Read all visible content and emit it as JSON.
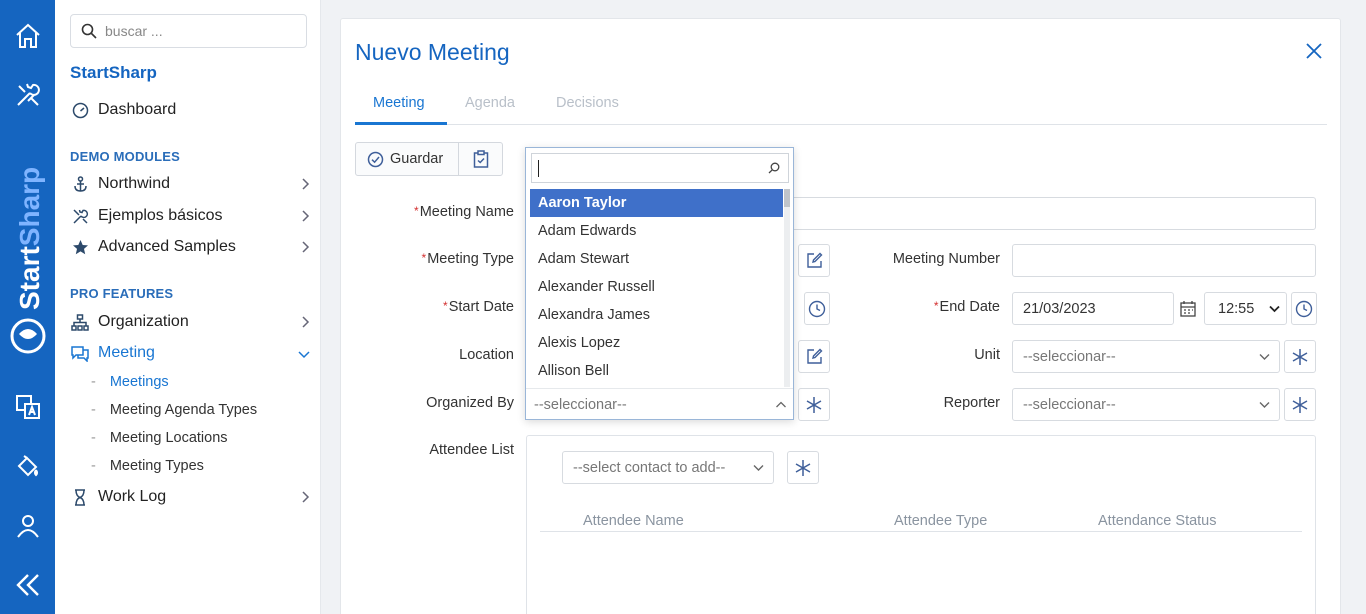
{
  "rail": {
    "brand_start": "Start",
    "brand_sharp": "Sharp"
  },
  "sidebar": {
    "search_placeholder": "buscar ...",
    "app_title": "StartSharp",
    "dashboard": "Dashboard",
    "sections": {
      "demo": "DEMO MODULES",
      "pro": "PRO FEATURES"
    },
    "items": {
      "northwind": "Northwind",
      "ejemplos": "Ejemplos básicos",
      "advanced": "Advanced Samples",
      "organization": "Organization",
      "meeting": "Meeting",
      "work_log": "Work Log"
    },
    "meeting_sub": [
      "Meetings",
      "Meeting Agenda Types",
      "Meeting Locations",
      "Meeting Types"
    ]
  },
  "dialog": {
    "title": "Nuevo Meeting",
    "tabs": [
      "Meeting",
      "Agenda",
      "Decisions"
    ],
    "save_label": "Guardar",
    "labels": {
      "meeting_name": "Meeting Name",
      "meeting_type": "Meeting Type",
      "start_date": "Start Date",
      "location": "Location",
      "organized_by": "Organized By",
      "attendee_list": "Attendee List",
      "meeting_number": "Meeting Number",
      "end_date": "End Date",
      "unit": "Unit",
      "reporter": "Reporter"
    },
    "values": {
      "end_date": "21/03/2023",
      "end_time": "12:55",
      "unit": "--seleccionar--",
      "reporter": "--seleccionar--",
      "organized_by": "--seleccionar--",
      "contact_add": "--select contact to add--"
    },
    "attendee_columns": [
      "Attendee Name",
      "Attendee Type",
      "Attendance Status"
    ]
  },
  "dropdown": {
    "options": [
      "Aaron Taylor",
      "Adam Edwards",
      "Adam Stewart",
      "Alexander Russell",
      "Alexandra James",
      "Alexis Lopez",
      "Allison Bell"
    ],
    "highlighted": "Aaron Taylor",
    "footer": "--seleccionar--"
  },
  "colors": {
    "rail": "#1565c0",
    "accent": "#1976d2",
    "highlight": "#3f70c9",
    "required": "#d32f2f"
  }
}
